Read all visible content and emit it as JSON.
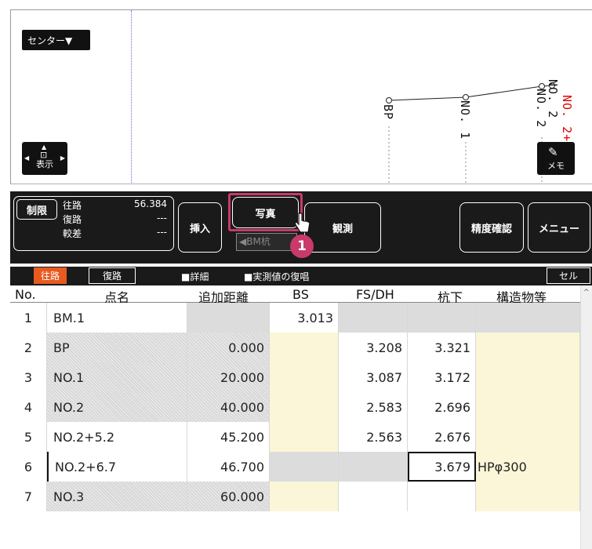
{
  "map": {
    "center_button": "センター▼",
    "view_button": "表示",
    "memo_button": "メモ",
    "labels": [
      "BP",
      "NO. 1",
      "NO. 2",
      "NO. 2"
    ],
    "red_label": "NO. 2+"
  },
  "toolbar": {
    "limit_button": "制限",
    "rows": [
      {
        "label": "往路",
        "value": "56.384"
      },
      {
        "label": "復路",
        "value": "---"
      },
      {
        "label": "較差",
        "value": "---"
      }
    ],
    "insert_button": "挿入",
    "photo_button": "写真",
    "observe_button": "観測",
    "bm_field": "◀BM杭",
    "accuracy_button": "精度確認",
    "menu_button": "メニュー",
    "callout_number": "1"
  },
  "tabs": {
    "outbound": "往路",
    "return": "復路",
    "detail_check": "■詳細",
    "restore_check": "■実測値の復唱",
    "cell_button": "セル"
  },
  "table": {
    "headers": [
      "No.",
      "点名",
      "追加距離",
      "BS",
      "FS/DH",
      "杭下",
      "構造物等"
    ],
    "rows": [
      {
        "no": "1",
        "name": "BM.1",
        "dist": "",
        "bs": "3.013",
        "fs": "",
        "kui": "",
        "struct": ""
      },
      {
        "no": "2",
        "name": "BP",
        "dist": "0.000",
        "bs": "",
        "fs": "3.208",
        "kui": "3.321",
        "struct": ""
      },
      {
        "no": "3",
        "name": "NO.1",
        "dist": "20.000",
        "bs": "",
        "fs": "3.087",
        "kui": "3.172",
        "struct": ""
      },
      {
        "no": "4",
        "name": "NO.2",
        "dist": "40.000",
        "bs": "",
        "fs": "2.583",
        "kui": "2.696",
        "struct": ""
      },
      {
        "no": "5",
        "name": "NO.2+5.2",
        "dist": "45.200",
        "bs": "",
        "fs": "2.563",
        "kui": "2.676",
        "struct": ""
      },
      {
        "no": "6",
        "name": "NO.2+6.7",
        "dist": "46.700",
        "bs": "",
        "fs": "",
        "kui": "3.679",
        "struct": "HPφ300"
      },
      {
        "no": "7",
        "name": "NO.3",
        "dist": "60.000",
        "bs": "",
        "fs": "",
        "kui": "",
        "struct": ""
      }
    ]
  }
}
